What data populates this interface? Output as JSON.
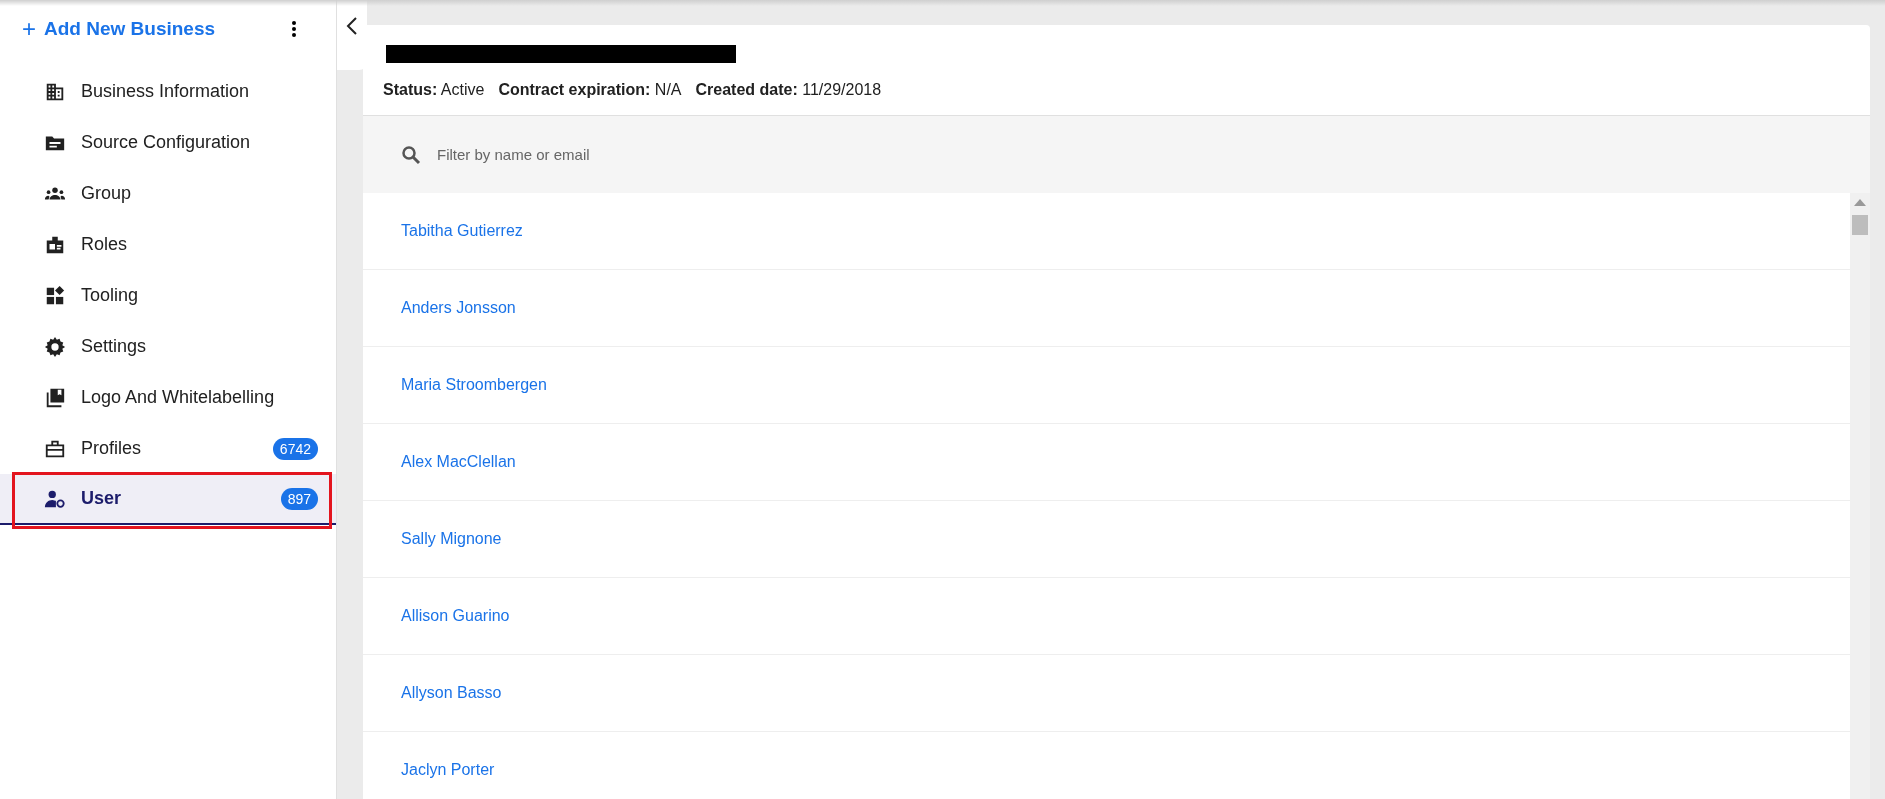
{
  "sidebar": {
    "add_button": {
      "icon": "+",
      "label": "Add New Business"
    },
    "items": [
      {
        "label": "Business Information",
        "selected": false
      },
      {
        "label": "Source Configuration",
        "selected": false
      },
      {
        "label": "Group",
        "selected": false
      },
      {
        "label": "Roles",
        "selected": false
      },
      {
        "label": "Tooling",
        "selected": false
      },
      {
        "label": "Settings",
        "selected": false
      },
      {
        "label": "Logo And Whitelabelling",
        "selected": false
      },
      {
        "label": "Profiles",
        "selected": false,
        "count": "6742"
      },
      {
        "label": "User",
        "selected": true,
        "count": "897",
        "highlighted": true
      }
    ]
  },
  "header": {
    "title_redacted": true,
    "meta": [
      {
        "label": "Status:",
        "value": "Active"
      },
      {
        "label": "Contract expiration:",
        "value": "N/A"
      },
      {
        "label": "Created date:",
        "value": "11/29/2018"
      }
    ]
  },
  "search": {
    "placeholder": "Filter by name or email"
  },
  "users": [
    "Tabitha Gutierrez",
    "Anders Jonsson",
    "Maria Stroombergen",
    "Alex MacClellan",
    "Sally Mignone",
    "Allison Guarino",
    "Allyson Basso",
    "Jaclyn Porter"
  ]
}
